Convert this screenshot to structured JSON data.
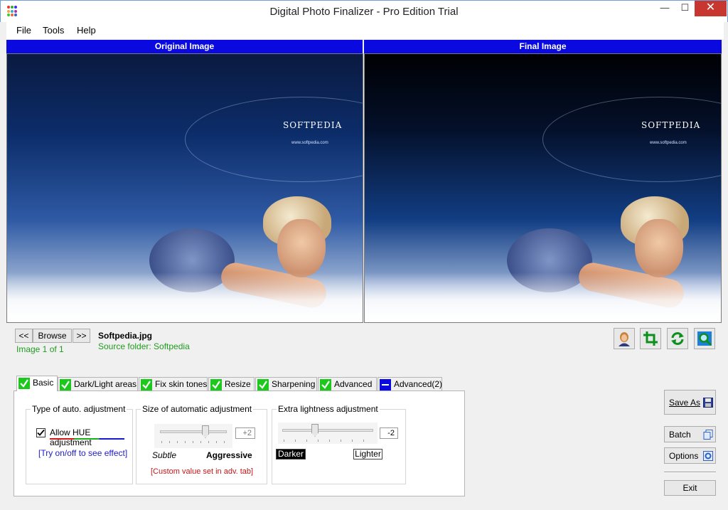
{
  "window": {
    "title": "Digital Photo Finalizer - Pro Edition Trial",
    "min_glyph": "—",
    "max_glyph": "☐",
    "close_glyph": "✕"
  },
  "menu": [
    "File",
    "Tools",
    "Help"
  ],
  "panels": {
    "original_label": "Original Image",
    "final_label": "Final Image"
  },
  "image_text": {
    "brand": "SOFTPEDIA",
    "url": "www.softpedia.com"
  },
  "navigation": {
    "prev_label": "<<",
    "browse_label": "Browse",
    "next_label": ">>",
    "counter": "Image 1 of 1",
    "filename": "Softpedia.jpg",
    "source_folder": "Source folder: Softpedia"
  },
  "tools": [
    {
      "name": "portrait-icon"
    },
    {
      "name": "crop-icon"
    },
    {
      "name": "rotate-icon"
    },
    {
      "name": "zoom-icon"
    }
  ],
  "tabs": [
    {
      "label": "Basic",
      "status": "checked",
      "active": true
    },
    {
      "label": "Dark/Light areas",
      "status": "checked",
      "active": false
    },
    {
      "label": "Fix skin tones",
      "status": "checked",
      "active": false
    },
    {
      "label": "Resize",
      "status": "checked",
      "active": false
    },
    {
      "label": "Sharpening",
      "status": "checked",
      "active": false
    },
    {
      "label": "Advanced",
      "status": "checked",
      "active": false
    },
    {
      "label": "Advanced(2)",
      "status": "off",
      "active": false
    }
  ],
  "basic": {
    "auto_type": {
      "title": "Type of auto. adjustment",
      "hue_label": "Allow HUE adjustment",
      "hue_checked": true,
      "hint": "[Try on/off to see effect]"
    },
    "size": {
      "title": "Size of automatic adjustment",
      "value": "+2",
      "min_label": "Subtle",
      "max_label": "Aggressive",
      "note": "[Custom value set in adv. tab]",
      "level_fraction": 0.68
    },
    "lightness": {
      "title": "Extra lightness adjustment",
      "value": "-2",
      "darker_label": "Darker",
      "lighter_label": "Lighter",
      "level_fraction": 0.36
    }
  },
  "actions": {
    "save_as": "Save As",
    "batch": "Batch",
    "options": "Options",
    "exit": "Exit"
  },
  "colors": {
    "header_blue": "#0a0ae0",
    "check_green": "#1dc81d",
    "close_red": "#c7372f",
    "status_green": "#1f9c1f",
    "note_red": "#c01818",
    "hint_blue": "#1c1cc8"
  }
}
